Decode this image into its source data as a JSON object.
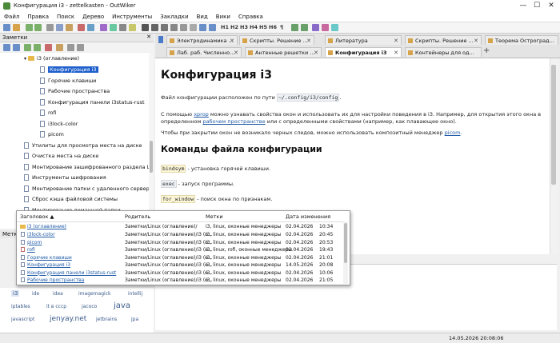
{
  "app": {
    "title": "Конфигурация i3 - zettelkasten - OutWiker",
    "window_controls": [
      "—",
      "☐",
      "✕"
    ]
  },
  "menu": [
    "Файл",
    "Правка",
    "Поиск",
    "Дерево",
    "Инструменты",
    "Закладки",
    "Вид",
    "Вики",
    "Справка"
  ],
  "toolbar": {
    "headings": [
      "H1",
      "H2",
      "H3",
      "H4",
      "H5",
      "H6"
    ],
    "pilcrow": "¶"
  },
  "notes_panel": {
    "title": "Заметки",
    "items": [
      {
        "label": "i3 (оглавление)",
        "type": "folder",
        "indent": 0
      },
      {
        "label": "Конфигурация i3",
        "type": "doc",
        "indent": 1,
        "selected": true
      },
      {
        "label": "Горячие клавиши",
        "type": "doc",
        "indent": 1
      },
      {
        "label": "Рабочие пространства",
        "type": "doc",
        "indent": 1
      },
      {
        "label": "Конфигурация панели i3status-rust",
        "type": "doc",
        "indent": 1
      },
      {
        "label": "rofi",
        "type": "doc",
        "indent": 1
      },
      {
        "label": "i3lock-color",
        "type": "doc",
        "indent": 1
      },
      {
        "label": "picom",
        "type": "doc",
        "indent": 1
      },
      {
        "label": "Утилиты для просмотра места на диске",
        "type": "doc",
        "indent": 0
      },
      {
        "label": "Очистка места на диске",
        "type": "doc",
        "indent": 0
      },
      {
        "label": "Монтирование зашифрованного раздела LUKS",
        "type": "doc",
        "indent": 0
      },
      {
        "label": "Инструменты шифрования",
        "type": "doc",
        "indent": 0
      },
      {
        "label": "Монтирование папки с удаленного сервера",
        "type": "doc",
        "indent": 0
      },
      {
        "label": "Сброс кэша файловой системы",
        "type": "doc",
        "indent": 0
      },
      {
        "label": "Монтирование домашней папки",
        "type": "doc",
        "indent": 0
      }
    ]
  },
  "tags_panel": {
    "title": "Метки",
    "tags": [
      "i3",
      "ide",
      "idea",
      "imagemagick",
      "intellij",
      "iptables",
      "it в сссp",
      "jacoco",
      "java",
      "javascript",
      "jenyay.net",
      "jetbrains",
      "jpa"
    ]
  },
  "tabs_row1": [
    {
      "label": "Электродинамика ..."
    },
    {
      "label": "Скрипты. Решение ..."
    },
    {
      "label": "Литература"
    },
    {
      "label": "Скрипты. Решение ..."
    },
    {
      "label": "Теорема Остроград..."
    }
  ],
  "tabs_row2": [
    {
      "label": "Лаб. раб. Численно...",
      "active": false
    },
    {
      "label": "Антенные решетки ...",
      "active": false
    },
    {
      "label": "Конфигурация i3",
      "active": true
    },
    {
      "label": "Контейнеры для од...",
      "active": false
    }
  ],
  "add_tab": "+",
  "page": {
    "title": "Конфигурация i3",
    "p1_before": "Файл конфигурации расположен по пути ",
    "p1_code": "~/.config/i3/config",
    "p1_after": ".",
    "p2_a": "С помощью ",
    "p2_link1": "xprop",
    "p2_b": " можно узнавать свойства окон и использовать их для настройки поведения в i3. Например, для открытия этого окна в",
    "p2_c": "определенном ",
    "p2_link2": "рабочем пространстве",
    "p2_d": " или с определенными свойствами (например, как плавающее окно).",
    "p3_a": "Чтобы при закрытии окон не возникало черных следов, можно использовать композитный менеджер ",
    "p3_link": "picom",
    "p3_b": ".",
    "h2": "Команды файла конфигурации",
    "cmd1_code": "bindsym",
    "cmd1_text": " - установка горячей клавиши.",
    "cmd2_code": "exec",
    "cmd2_text": " - запуск программы.",
    "cmd3_code": "for_window",
    "cmd3_text": " - поиск окна по признакам."
  },
  "popup": {
    "columns": [
      "Заголовок ▲",
      "Родитель",
      "Метки",
      "Дата изменения"
    ],
    "rows": [
      {
        "title": "i3 (оглавление)",
        "parent": "Заметки/Linux (оглавление)/",
        "tags": "i3, linux, оконные менеджеры",
        "date": "02.04.2026",
        "time": "10:34",
        "folder": true
      },
      {
        "title": "i3lock-color",
        "parent": "Заметки/Linux (оглавление)/i3 (о...",
        "tags": "i3, linux, оконные менеджеры",
        "date": "02.04.2026",
        "time": "20:45"
      },
      {
        "title": "picom",
        "parent": "Заметки/Linux (оглавление)/i3 (о...",
        "tags": "i3, linux, оконные менеджеры",
        "date": "02.04.2026",
        "time": "20:53"
      },
      {
        "title": "rofi",
        "parent": "Заметки/Linux (оглавление)/i3 (о...",
        "tags": "i3, linux, rofi, оконные менеджеры",
        "date": "02.04.2026",
        "time": "19:43"
      },
      {
        "title": "Горячие клавиши",
        "parent": "Заметки/Linux (оглавление)/i3 (о...",
        "tags": "i3, linux, оконные менеджеры",
        "date": "02.04.2026",
        "time": "21:01"
      },
      {
        "title": "Конфигурация i3",
        "parent": "Заметки/Linux (оглавление)/i3 (о...",
        "tags": "i3, linux, оконные менеджеры",
        "date": "14.05.2026",
        "time": "20:08"
      },
      {
        "title": "Конфигурация панели i3status-rust",
        "parent": "Заметки/Linux (оглавление)/i3 (о...",
        "tags": "i3, linux, оконные менеджеры",
        "date": "02.04.2026",
        "time": "10:06"
      },
      {
        "title": "Рабочие пространства",
        "parent": "Заметки/Linux (оглавление)/i3 (о...",
        "tags": "i3, linux, оконные менеджеры",
        "date": "02.04.2026",
        "time": "21:05"
      }
    ]
  },
  "status": {
    "datetime": "14.05.2026 20:08:06"
  }
}
